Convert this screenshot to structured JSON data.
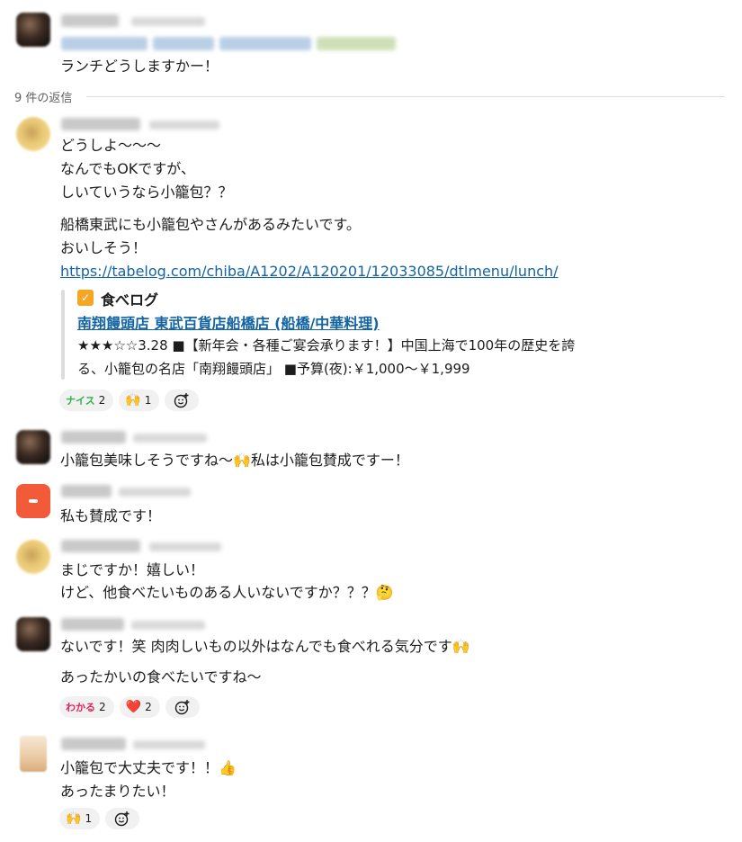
{
  "parent": {
    "text": "ランチどうしますかー！"
  },
  "thread": {
    "reply_count": "9 件の返信"
  },
  "messages": [
    {
      "lines": [
        "どうしよ〜〜〜",
        "なんでもOKですが、",
        "しいていうなら小籠包？？"
      ],
      "lines2": [
        "船橋東武にも小籠包やさんがあるみたいです。",
        "おいしそう！"
      ],
      "link": "https://tabelog.com/chiba/A1202/A120201/12033085/dtlmenu/lunch/",
      "unfurl": {
        "site": "食べログ",
        "title": "南翔饅頭店 東武百貨店船橋店 (船橋/中華料理)",
        "desc1": "★★★☆☆3.28 ■【新年会・各種ご宴会承ります！】中国上海で100年の歴史を誇",
        "desc2": "る、小籠包の名店「南翔饅頭店」 ■予算(夜):￥1,000〜￥1,999"
      },
      "reactions": [
        {
          "emoji": "nice-emoji",
          "tag": "ナイス",
          "count": "2"
        },
        {
          "emoji": "raised-hands-emoji",
          "glyph": "🙌",
          "count": "1"
        }
      ]
    },
    {
      "lines": [
        "小籠包美味しそうですね〜🙌私は小籠包賛成ですー！"
      ]
    },
    {
      "lines": [
        "私も賛成です！"
      ]
    },
    {
      "lines": [
        "まじですか！嬉しい！",
        "けど、他食べたいものある人いないですか？？？🤔"
      ]
    },
    {
      "lines": [
        "ないです！笑 肉肉しいもの以外はなんでも食べれる気分です🙌"
      ],
      "lines2": [
        "あったかいの食べたいですね〜"
      ],
      "reactions": [
        {
          "emoji": "wakaru-emoji",
          "tag": "わかる",
          "count": "2"
        },
        {
          "emoji": "heart-emoji",
          "glyph": "❤️",
          "count": "2"
        }
      ]
    },
    {
      "lines": [
        "小籠包で大丈夫です！！👍",
        "あったまりたい！"
      ],
      "reactions": [
        {
          "emoji": "raised-hands-emoji",
          "glyph": "🙌",
          "count": "1"
        }
      ]
    }
  ],
  "colors": {
    "link": "#1264a3",
    "reaction_bg": "#f1f1f1",
    "divider": "#dddddd"
  }
}
